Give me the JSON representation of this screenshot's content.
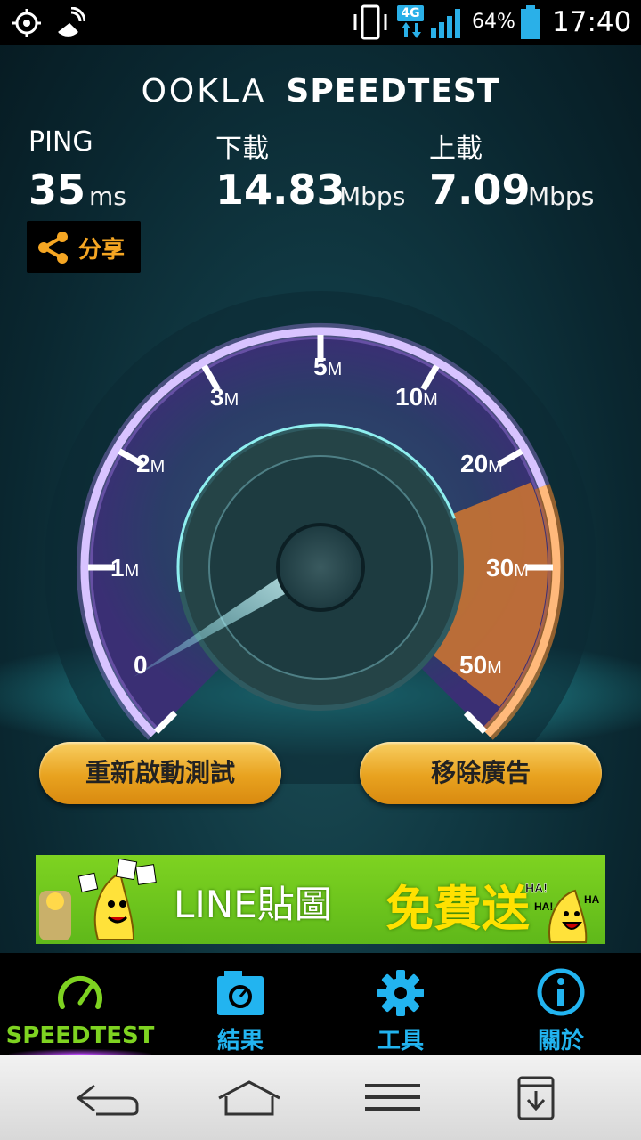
{
  "status_bar": {
    "network": "4G",
    "battery": "64%",
    "time": "17:40",
    "icons": [
      "gps-icon",
      "satellite-dish-icon",
      "vibrate-icon",
      "network-4g-icon",
      "signal-icon",
      "battery-icon"
    ]
  },
  "header": {
    "brand": "OOKLA",
    "product": "SPEEDTEST"
  },
  "results": {
    "ping": {
      "label": "PING",
      "value": "35",
      "unit": "ms"
    },
    "download": {
      "label": "下載",
      "value": "14.83",
      "unit": "Mbps"
    },
    "upload": {
      "label": "上載",
      "value": "7.09",
      "unit": "Mbps"
    }
  },
  "share": {
    "label": "分享",
    "icon": "share-icon"
  },
  "gauge": {
    "tick_labels": [
      {
        "num": "0",
        "unit": ""
      },
      {
        "num": "1",
        "unit": "M"
      },
      {
        "num": "2",
        "unit": "M"
      },
      {
        "num": "3",
        "unit": "M"
      },
      {
        "num": "5",
        "unit": "M"
      },
      {
        "num": "10",
        "unit": "M"
      },
      {
        "num": "20",
        "unit": "M"
      },
      {
        "num": "30",
        "unit": "M"
      },
      {
        "num": "50",
        "unit": "M"
      }
    ],
    "accent_purple": "#b98cff",
    "accent_orange": "#ff8a2a"
  },
  "actions": {
    "restart": "重新啟動測試",
    "remove_ads": "移除廣告"
  },
  "ad": {
    "text_main": "LINE貼圖",
    "text_highlight": "免費送"
  },
  "tabs": [
    {
      "label": "SPEEDTEST",
      "icon": "speedometer-icon",
      "color": "#7ed321",
      "active": true
    },
    {
      "label": "結果",
      "icon": "results-icon",
      "color": "#22b4f0",
      "active": false
    },
    {
      "label": "工具",
      "icon": "gear-icon",
      "color": "#22b4f0",
      "active": false
    },
    {
      "label": "關於",
      "icon": "info-icon",
      "color": "#22b4f0",
      "active": false
    }
  ],
  "nav": {
    "icons": [
      "back-icon",
      "home-icon",
      "menu-icon",
      "download-icon"
    ]
  }
}
